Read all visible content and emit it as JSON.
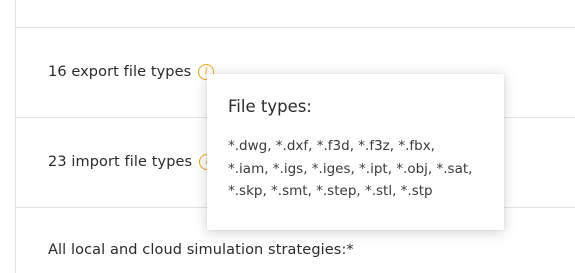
{
  "rows": [
    {
      "label": "16 export file types"
    },
    {
      "label": "23 import file types"
    },
    {
      "label": "All local and cloud simulation strategies:*"
    }
  ],
  "icons": {
    "info": "info-icon",
    "accent_color": "#f0a51e"
  },
  "tooltip": {
    "title": "File types:",
    "lines": [
      "*.dwg, *.dxf, *.f3d, *.f3z, *.fbx,",
      "*.iam, *.igs, *.iges, *.ipt, *.obj, *.sat,",
      "*.skp, *.smt, *.step, *.stl, *.stp"
    ]
  }
}
